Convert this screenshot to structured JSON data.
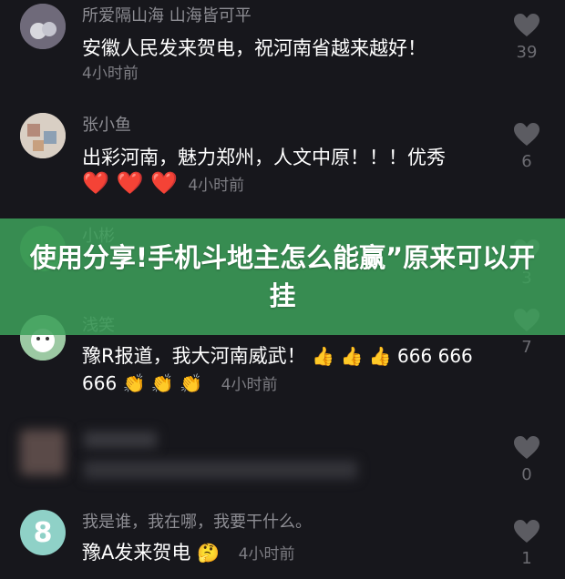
{
  "banner": {
    "title": "使用分享!手机斗地主怎么能赢”原来可以开挂"
  },
  "comments": [
    {
      "username": "所爱隔山海 山海皆可平",
      "text": "安徽人民发来贺电，祝河南省越来越好！",
      "time": "4小时前",
      "likes": "39",
      "avatar_color": "#6f6a7a"
    },
    {
      "username": "张小鱼",
      "text": "出彩河南，魅力郑州，人文中原！！！优秀",
      "emojis": "❤️ ❤️ ❤️",
      "time": "4小时前",
      "likes": "6",
      "avatar_color": "#d9cfc4"
    },
    {
      "username": "小彬",
      "likes": "3",
      "avatar_color": "#3f7a45"
    },
    {
      "username": "浅笑",
      "text": "豫R报道，我大河南威武！",
      "emojis_line1": "👍 👍 👍 666 666",
      "emojis_line2": "666 👏 👏 👏",
      "time": "4小时前",
      "likes": "7",
      "avatar_color": "#9cc9a3"
    },
    {
      "likes": "0"
    },
    {
      "username": "我是谁，我在哪，我要干什么。",
      "text": "豫A发来贺电",
      "emojis": "🤔",
      "time": "4小时前",
      "likes": "1",
      "avatar_color": "#8fd1c7",
      "avatar_label": "8"
    }
  ]
}
